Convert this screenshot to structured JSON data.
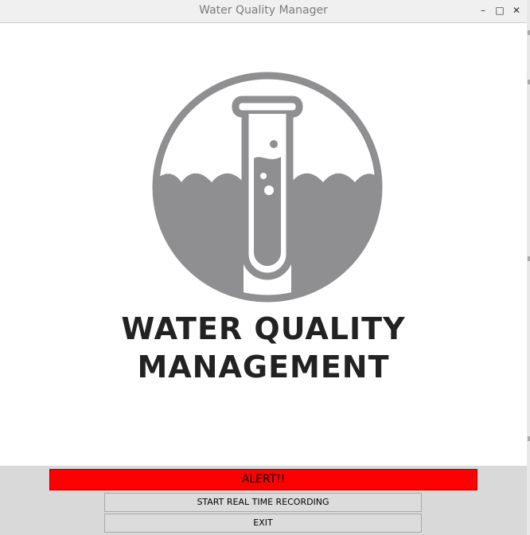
{
  "window": {
    "title": "Water Quality Manager",
    "controls": {
      "minimize": "–",
      "maximize": "□",
      "close": "✕"
    }
  },
  "logo": {
    "icon": "test-tube-water-icon",
    "line1": "WATER QUALITY",
    "line2": "MANAGEMENT",
    "color": "#8f8f91"
  },
  "alert": {
    "text": "ALERT!!",
    "color": "#ff0000"
  },
  "buttons": {
    "start_label": "START REAL TIME RECORDING",
    "exit_label": "EXIT"
  }
}
